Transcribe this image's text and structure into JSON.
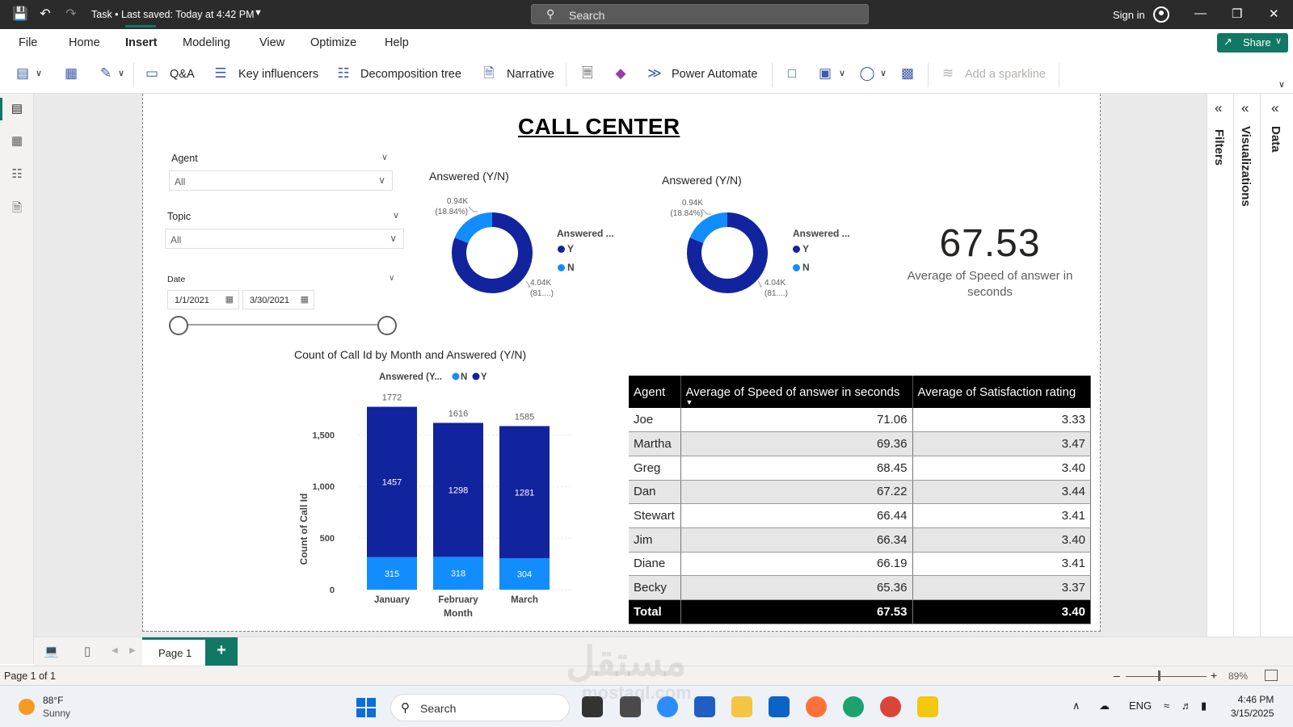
{
  "titlebar": {
    "doc_title": "Task • Last saved: Today at 4:42 PM",
    "search_placeholder": "Search",
    "sign_in": "Sign in"
  },
  "menu": {
    "items": [
      "File",
      "Home",
      "Insert",
      "Modeling",
      "View",
      "Optimize",
      "Help"
    ],
    "active": "Insert",
    "share_label": "Share"
  },
  "toolbar": {
    "qa": "Q&A",
    "key_influencers": "Key influencers",
    "decomposition_tree": "Decomposition tree",
    "narrative": "Narrative",
    "power_automate": "Power Automate",
    "add_sparkline": "Add a sparkline"
  },
  "report": {
    "title": "CALL CENTER",
    "slicers": {
      "agent": {
        "label": "Agent",
        "value": "All"
      },
      "topic": {
        "label": "Topic",
        "value": "All"
      },
      "date": {
        "label": "Date",
        "start": "1/1/2021",
        "end": "3/30/2021"
      }
    },
    "donut1": {
      "title": "Answered (Y/N)",
      "legend_title": "Answered ...",
      "legend": [
        "Y",
        "N"
      ],
      "label_n_value": "0.94K",
      "label_n_pct": "(18.84%)",
      "label_y_value": "4.04K",
      "label_y_pct": "(81....)"
    },
    "donut2": {
      "title": "Answered (Y/N)",
      "legend_title": "Answered ...",
      "legend": [
        "Y",
        "N"
      ],
      "label_n_value": "0.94K",
      "label_n_pct": "(18.84%)",
      "label_y_value": "4.04K",
      "label_y_pct": "(81....)"
    },
    "kpi": {
      "value": "67.53",
      "label": "Average of Speed of answer in seconds"
    },
    "table": {
      "columns": [
        "Agent",
        "Average of Speed of answer in seconds",
        "Average of Satisfaction rating"
      ],
      "rows": [
        [
          "Joe",
          "71.06",
          "3.33"
        ],
        [
          "Martha",
          "69.36",
          "3.47"
        ],
        [
          "Greg",
          "68.45",
          "3.40"
        ],
        [
          "Dan",
          "67.22",
          "3.44"
        ],
        [
          "Stewart",
          "66.44",
          "3.41"
        ],
        [
          "Jim",
          "66.34",
          "3.40"
        ],
        [
          "Diane",
          "66.19",
          "3.41"
        ],
        [
          "Becky",
          "65.36",
          "3.37"
        ]
      ],
      "total": [
        "Total",
        "67.53",
        "3.40"
      ]
    }
  },
  "chart_data": [
    {
      "type": "bar",
      "title": "Count of Call Id by Month and Answered (Y/N)",
      "legend_title": "Answered (Y...",
      "legend": [
        "N",
        "Y"
      ],
      "xlabel": "Month",
      "ylabel": "Count of Call Id",
      "categories": [
        "January",
        "February",
        "March"
      ],
      "series": [
        {
          "name": "N",
          "values": [
            315,
            318,
            304
          ],
          "color": "#118dff"
        },
        {
          "name": "Y",
          "values": [
            1457,
            1298,
            1281
          ],
          "color": "#12239e"
        }
      ],
      "totals": [
        1772,
        1616,
        1585
      ],
      "yticks": [
        "0",
        "500",
        "1,000",
        "1,500"
      ],
      "ylim": [
        0,
        1800
      ],
      "stacked": true
    },
    {
      "type": "pie",
      "title": "Answered (Y/N)",
      "categories": [
        "Y",
        "N"
      ],
      "values": [
        4040,
        940
      ],
      "donut": true,
      "colors": [
        "#12239e",
        "#118dff"
      ]
    },
    {
      "type": "pie",
      "title": "Answered (Y/N)",
      "categories": [
        "Y",
        "N"
      ],
      "values": [
        4040,
        940
      ],
      "donut": true,
      "colors": [
        "#12239e",
        "#118dff"
      ]
    }
  ],
  "panes": {
    "filters": "Filters",
    "visualizations": "Visualizations",
    "data": "Data"
  },
  "tabs": {
    "page1": "Page 1",
    "add": "+"
  },
  "status": {
    "page_indicator": "Page 1 of 1",
    "zoom": "89%",
    "zoom_level": 0.4
  },
  "taskbar": {
    "weather_temp": "88°F",
    "weather_desc": "Sunny",
    "search_placeholder": "Search",
    "lang": "ENG",
    "time": "4:46 PM",
    "date": "3/15/2025"
  },
  "watermark": {
    "text": "مستقل",
    "sub": "mostaql.com"
  },
  "colors": {
    "accent": "#117865",
    "series_y": "#12239e",
    "series_n": "#118dff"
  }
}
